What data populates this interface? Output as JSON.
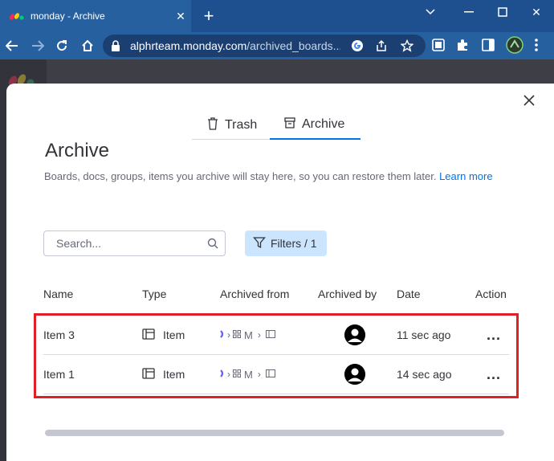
{
  "browser": {
    "tab_title": "monday - Archive",
    "new_tab_label": "+",
    "url_host": "alphrteam.monday.com",
    "url_path": "/archived_boards...",
    "window_controls": [
      "chevron-down",
      "minimize",
      "maximize",
      "close"
    ]
  },
  "modal": {
    "tabs": [
      {
        "label": "Trash",
        "icon": "trash-icon",
        "active": false
      },
      {
        "label": "Archive",
        "icon": "archive-icon",
        "active": true
      }
    ],
    "title": "Archive",
    "description": "Boards, docs, groups, items you archive will stay here, so you can restore them later.",
    "learn_more": "Learn more",
    "search": {
      "placeholder": "Search..."
    },
    "filters_label": "Filters / 1",
    "columns": [
      "Name",
      "Type",
      "Archived from",
      "Archived by",
      "Date",
      "Action"
    ],
    "rows": [
      {
        "name": "Item 3",
        "type": "Item",
        "archived_from": "M",
        "date": "11 sec ago",
        "action": "..."
      },
      {
        "name": "Item 1",
        "type": "Item",
        "archived_from": "M",
        "date": "14 sec ago",
        "action": "..."
      }
    ]
  },
  "colors": {
    "accent": "#0073ea",
    "highlight": "#e01f26",
    "browser_frame": "#27609f"
  }
}
